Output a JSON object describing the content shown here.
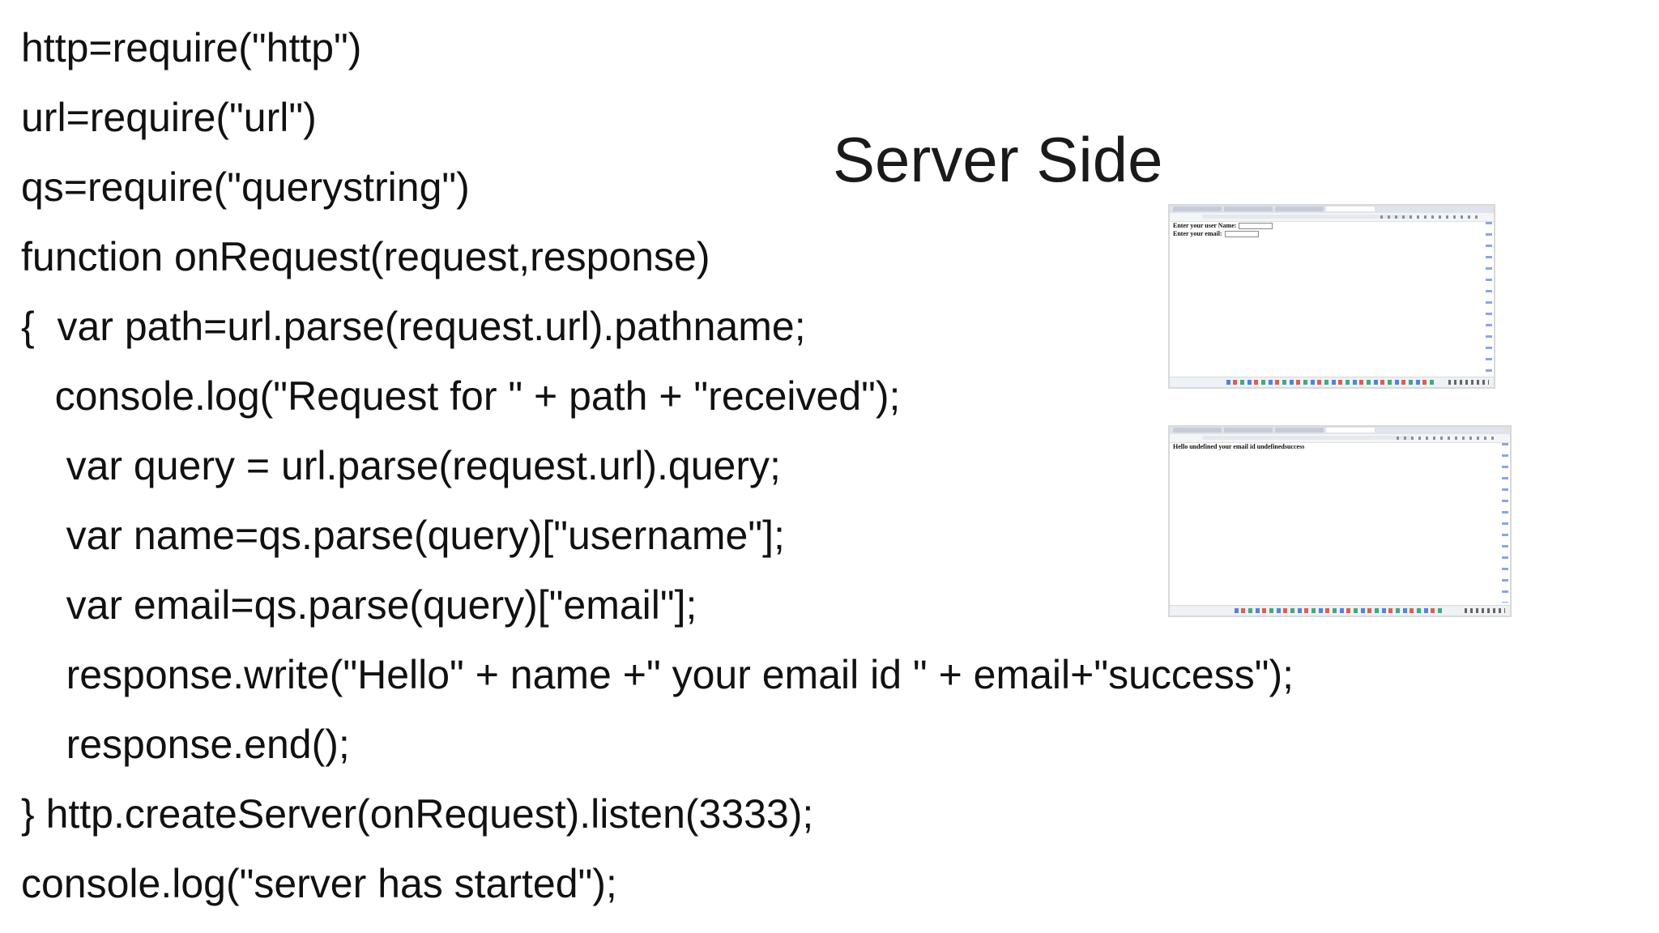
{
  "slide": {
    "title": "Server Side",
    "code_lines": [
      "http=require(\"http\")",
      "url=require(\"url\")",
      "qs=require(\"querystring\")",
      "function onRequest(request,response)",
      "{  var path=url.parse(request.url).pathname;",
      "   console.log(\"Request for \" + path + \"received\");",
      "    var query = url.parse(request.url).query;",
      "    var name=qs.parse(query)[\"username\"];",
      "    var email=qs.parse(query)[\"email\"];",
      "    response.write(\"Hello\" + name +\" your email id \" + email+\"success\");",
      "    response.end();",
      "} http.createServer(onRequest).listen(3333);",
      "console.log(\"server has started\");"
    ]
  },
  "screenshots": {
    "form_page": {
      "label_username": "Enter your user Name:",
      "label_email": "Enter your email:"
    },
    "response_page": {
      "text": "Hello undefined your email id undefinedsuccess"
    }
  }
}
